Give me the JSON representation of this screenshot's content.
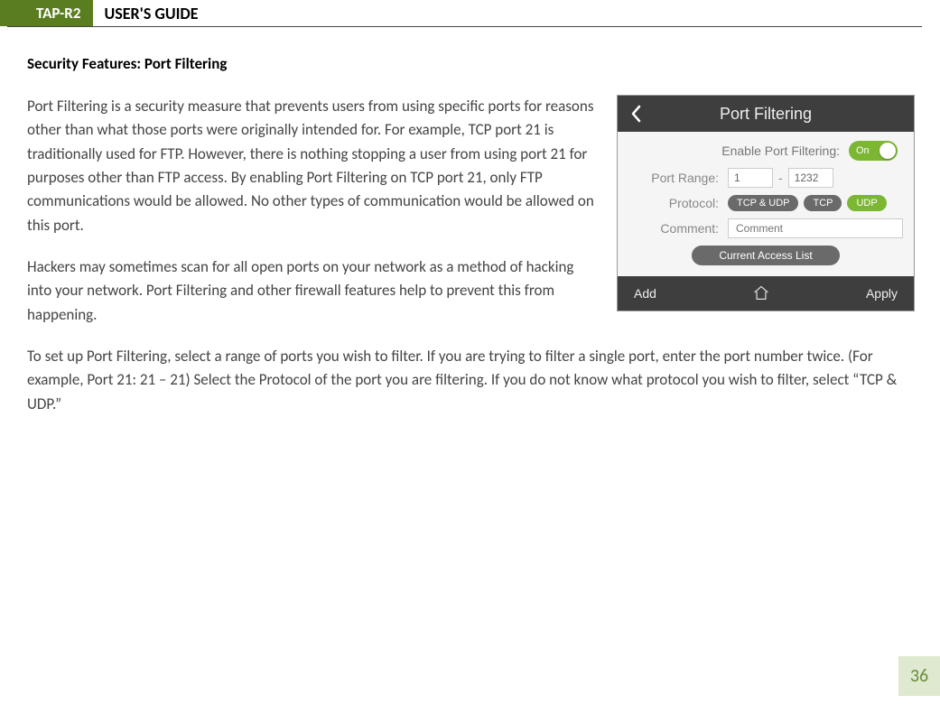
{
  "header": {
    "product": "TAP-R2",
    "doc_title": "USER'S GUIDE"
  },
  "section_heading": "Security Features: Port Filtering",
  "paragraphs": {
    "p1": "Port Filtering is a security measure that prevents users from using specific ports for reasons other than what those ports were originally intended for.  For example, TCP port 21 is traditionally used for FTP.  However, there is nothing stopping a user from using port 21 for purposes other than FTP access.  By enabling Port Filtering on TCP port 21, only FTP communications would be allowed.  No other types of communication would be allowed on this port.",
    "p2": "Hackers may sometimes scan for all open ports on your network as a method of hacking into your network.  Port Filtering and other firewall features help to prevent this from happening.",
    "p3": "To set up Port Filtering, select a range of ports you wish to filter.  If you are trying to filter a single port, enter the port number twice.  (For example, Port 21:  21 – 21) Select the Protocol of the port you are filtering.  If you do not know what protocol you wish to filter, select “TCP & UDP.”"
  },
  "device": {
    "title": "Port Filtering",
    "enable_label": "Enable Port Filtering:",
    "toggle_text": "On",
    "port_range_label": "Port Range:",
    "port_from": "1",
    "port_to": "1232",
    "protocol_label": "Protocol:",
    "protocol_options": {
      "both": "TCP & UDP",
      "tcp": "TCP",
      "udp": "UDP"
    },
    "comment_label": "Comment:",
    "comment_placeholder": "Comment",
    "access_list_btn": "Current Access List",
    "footer_add": "Add",
    "footer_apply": "Apply"
  },
  "page_number": "36"
}
